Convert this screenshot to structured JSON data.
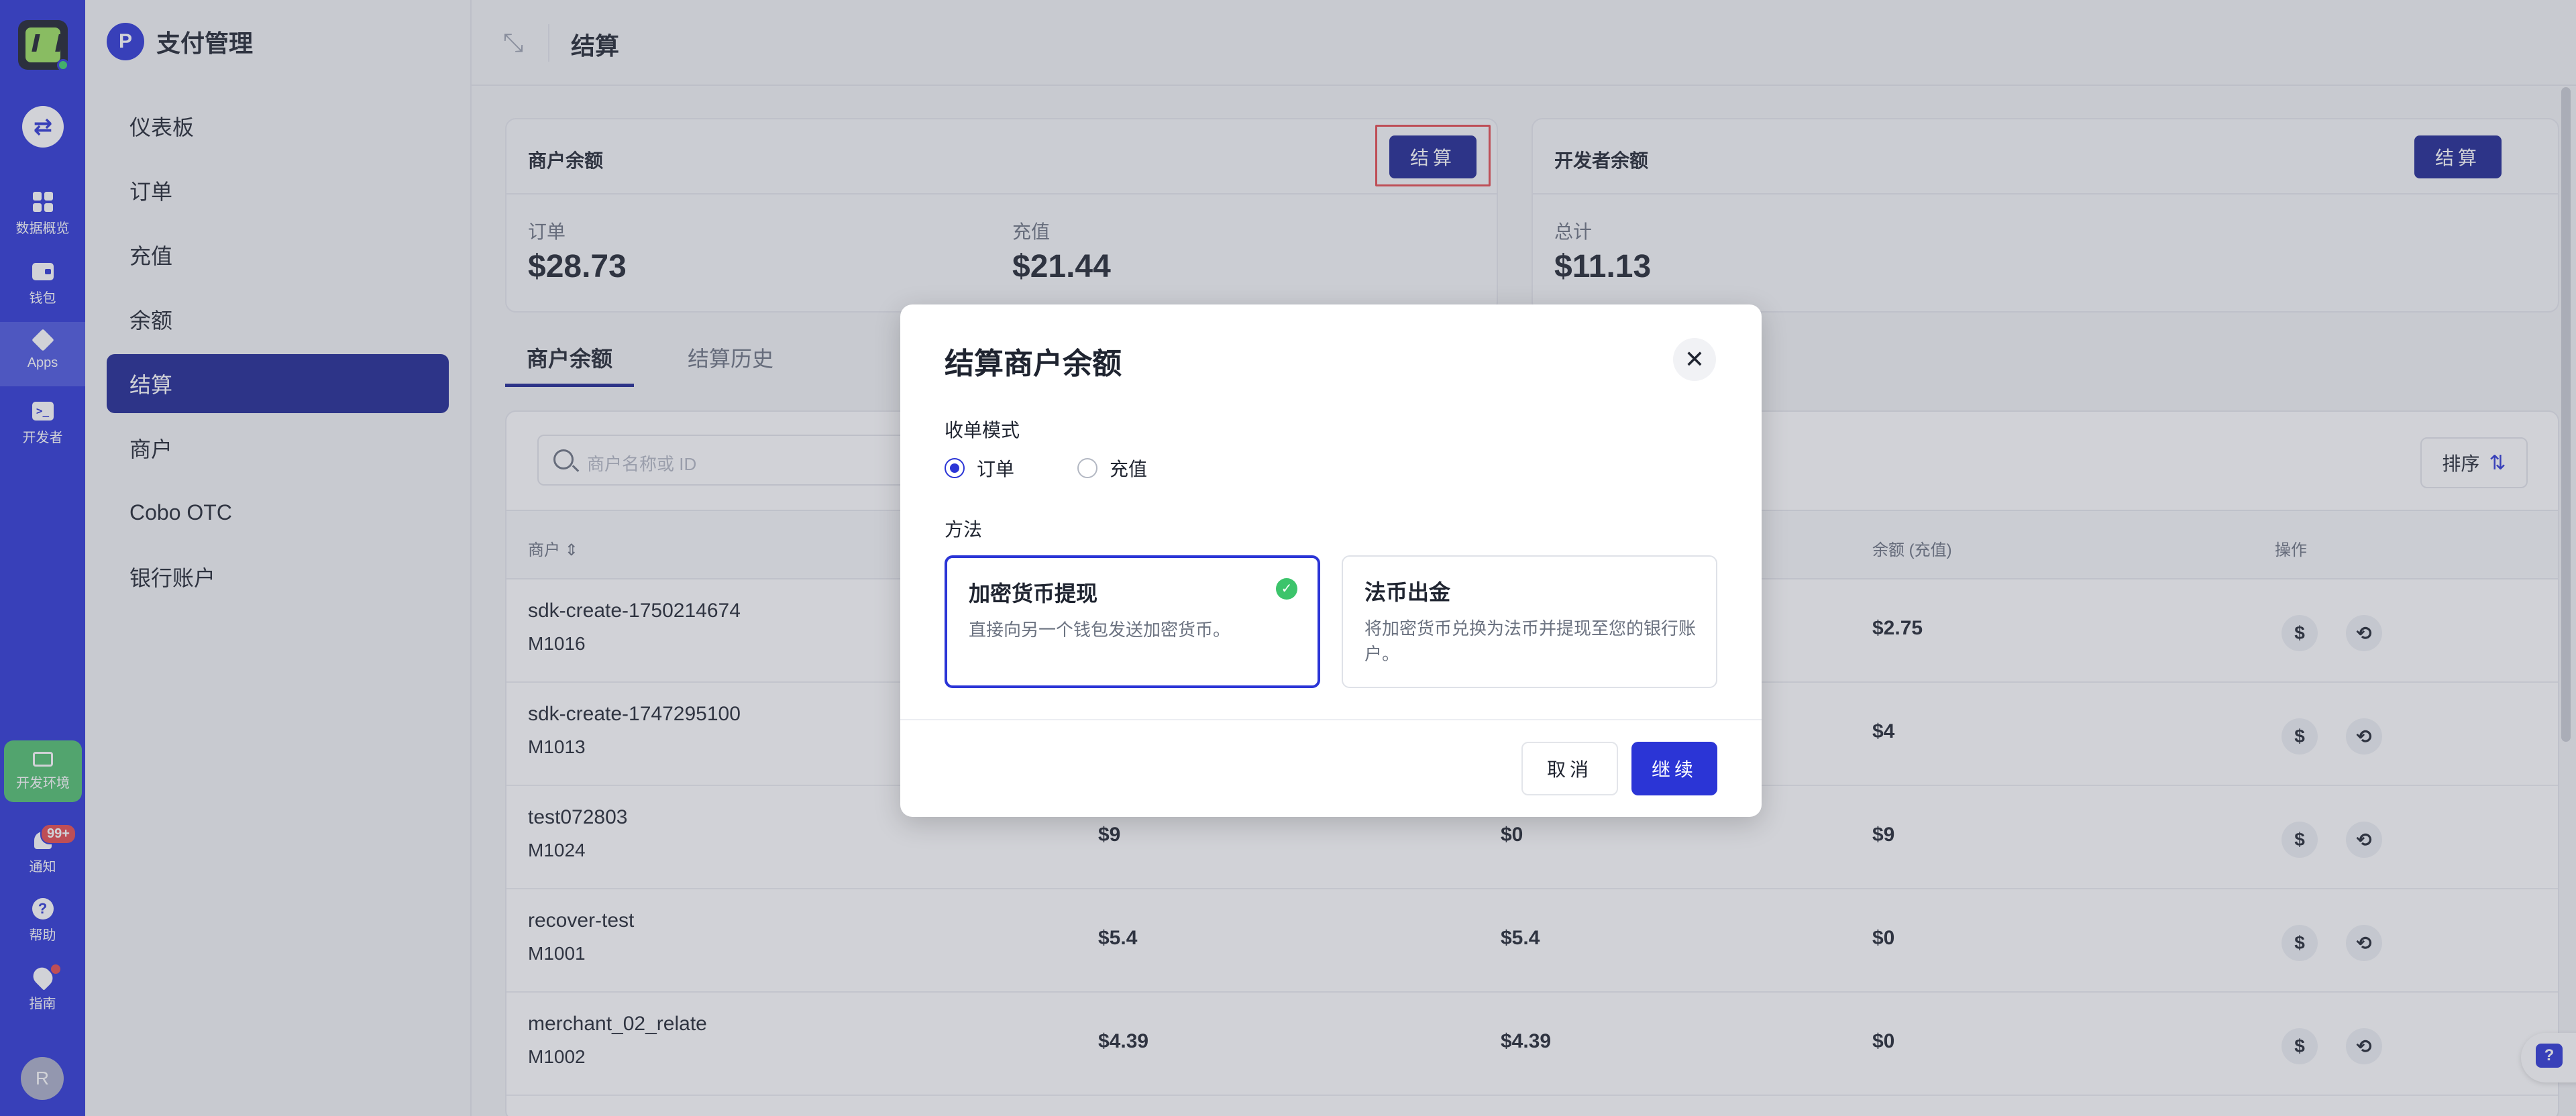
{
  "rail": {
    "items": [
      {
        "label": "数据概览",
        "icon": "dashboard-icon"
      },
      {
        "label": "钱包",
        "icon": "wallet-icon"
      },
      {
        "label": "Apps",
        "icon": "apps-icon"
      },
      {
        "label": "开发者",
        "icon": "terminal-icon"
      }
    ],
    "env_label": "开发环境",
    "notify_label": "通知",
    "notify_badge": "99+",
    "help_label": "帮助",
    "guide_label": "指南",
    "avatar_initial": "R",
    "accent": "#2b35d6"
  },
  "sidebar": {
    "title": "支付管理",
    "items": [
      "仪表板",
      "订单",
      "充值",
      "余额",
      "结算",
      "商户",
      "Cobo OTC",
      "银行账户"
    ],
    "active_index": 4
  },
  "topbar": {
    "title": "结算"
  },
  "merchant_card": {
    "title": "商户余额",
    "button": "结算",
    "stats": [
      {
        "label": "订单",
        "value": "$28.73"
      },
      {
        "label": "充值",
        "value": "$21.44"
      }
    ]
  },
  "dev_card": {
    "title": "开发者余额",
    "button": "结算",
    "stat": {
      "label": "总计",
      "value": "$11.13"
    }
  },
  "tabs": [
    "商户余额",
    "结算历史"
  ],
  "search": {
    "placeholder": "商户名称或 ID"
  },
  "sort": {
    "label": "排序"
  },
  "table": {
    "headers": {
      "merchant": "商户",
      "balance_topup": "余额 (充值)",
      "actions": "操作"
    },
    "rows": [
      {
        "name": "sdk-create-1750214674",
        "id": "M1016",
        "c1": "",
        "c2": "",
        "c3": "$2.75"
      },
      {
        "name": "sdk-create-1747295100",
        "id": "M1013",
        "c1": "",
        "c2": "",
        "c3": "$4"
      },
      {
        "name": "test072803",
        "id": "M1024",
        "c1": "$9",
        "c2": "$0",
        "c3": "$9"
      },
      {
        "name": "recover-test",
        "id": "M1001",
        "c1": "$5.4",
        "c2": "$5.4",
        "c3": "$0"
      },
      {
        "name": "merchant_02_relate",
        "id": "M1002",
        "c1": "$4.39",
        "c2": "$4.39",
        "c3": "$0"
      }
    ]
  },
  "modal": {
    "title": "结算商户余额",
    "mode_label": "收单模式",
    "modes": [
      "订单",
      "充值"
    ],
    "selected_mode": 0,
    "method_label": "方法",
    "options": [
      {
        "title": "加密货币提现",
        "desc": "直接向另一个钱包发送加密货币。"
      },
      {
        "title": "法币出金",
        "desc": "将加密货币兑换为法币并提现至您的银行账户。"
      }
    ],
    "cancel": "取消",
    "continue": "继续"
  }
}
